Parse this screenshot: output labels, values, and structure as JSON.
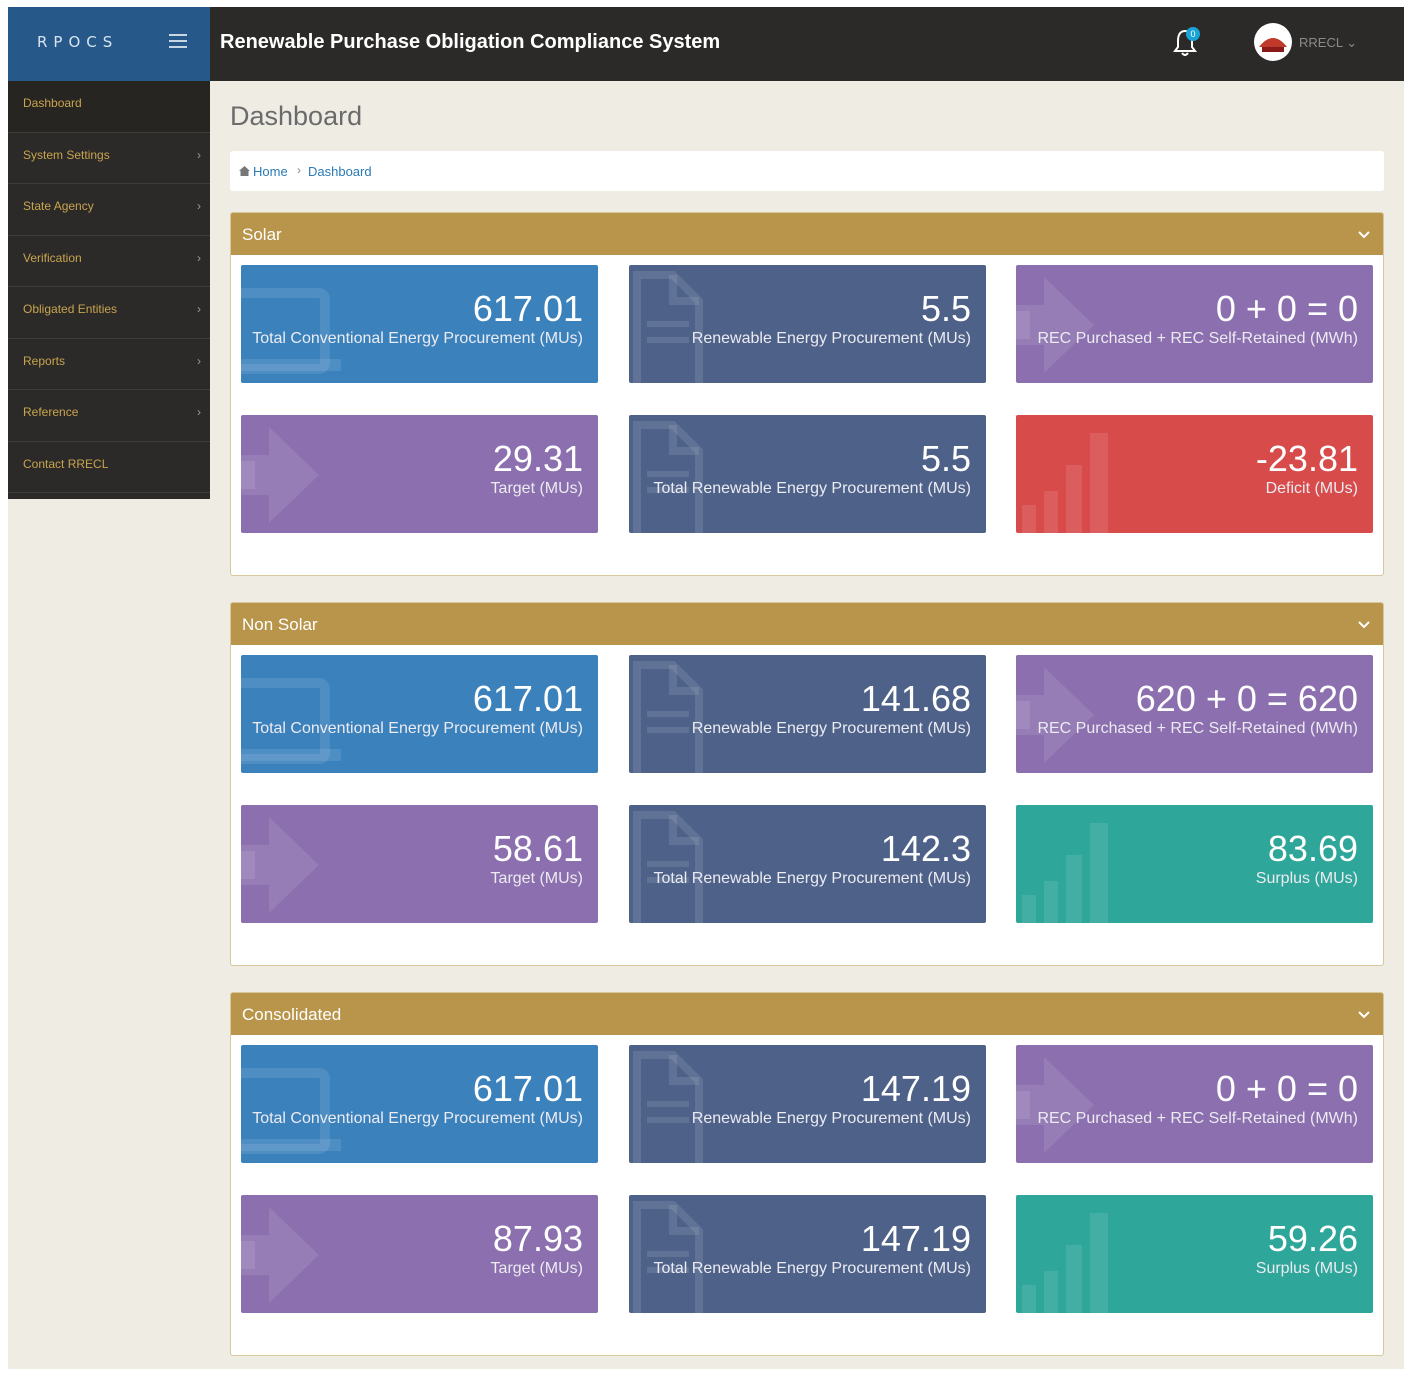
{
  "app": {
    "brand": "RPOCS",
    "title": "Renewable Purchase Obligation Compliance System",
    "notification_count": "0",
    "user": "RRECL"
  },
  "sidebar": {
    "items": [
      {
        "label": "Dashboard",
        "has_submenu": false
      },
      {
        "label": "System Settings",
        "has_submenu": true
      },
      {
        "label": "State Agency",
        "has_submenu": true
      },
      {
        "label": "Verification",
        "has_submenu": true
      },
      {
        "label": "Obligated Entities",
        "has_submenu": true
      },
      {
        "label": "Reports",
        "has_submenu": true
      },
      {
        "label": "Reference",
        "has_submenu": true
      },
      {
        "label": "Contact RRECL",
        "has_submenu": false
      }
    ]
  },
  "page": {
    "title": "Dashboard",
    "breadcrumb": [
      "Home",
      "Dashboard"
    ]
  },
  "colors": {
    "blue": "#3b82bd",
    "slate": "#4e6289",
    "purple": "#8b6fae",
    "red": "#d84b4b",
    "teal": "#2ea69a",
    "panel_header": "#b8954a"
  },
  "panels": [
    {
      "title": "Solar",
      "tiles": [
        {
          "value": "617.01",
          "label": "Total Conventional Energy Procurement (MUs)",
          "color": "blue",
          "icon": "document-icon"
        },
        {
          "value": "5.5",
          "label": "Renewable Energy Procurement (MUs)",
          "color": "slate",
          "icon": "file-icon"
        },
        {
          "value": "0 + 0 = 0",
          "label": "REC Purchased + REC Self-Retained (MWh)",
          "color": "purple",
          "icon": "arrow-icon"
        },
        {
          "value": "29.31",
          "label": "Target (MUs)",
          "color": "purple",
          "icon": "arrow-icon"
        },
        {
          "value": "5.5",
          "label": "Total Renewable Energy Procurement (MUs)",
          "color": "slate",
          "icon": "file-icon"
        },
        {
          "value": "-23.81",
          "label": "Deficit (MUs)",
          "color": "red",
          "icon": "bar-chart-icon"
        }
      ]
    },
    {
      "title": "Non Solar",
      "tiles": [
        {
          "value": "617.01",
          "label": "Total Conventional Energy Procurement (MUs)",
          "color": "blue",
          "icon": "document-icon"
        },
        {
          "value": "141.68",
          "label": "Renewable Energy Procurement (MUs)",
          "color": "slate",
          "icon": "file-icon"
        },
        {
          "value": "620 + 0 = 620",
          "label": "REC Purchased + REC Self-Retained (MWh)",
          "color": "purple",
          "icon": "arrow-icon"
        },
        {
          "value": "58.61",
          "label": "Target (MUs)",
          "color": "purple",
          "icon": "arrow-icon"
        },
        {
          "value": "142.3",
          "label": "Total Renewable Energy Procurement (MUs)",
          "color": "slate",
          "icon": "file-icon"
        },
        {
          "value": "83.69",
          "label": "Surplus (MUs)",
          "color": "teal",
          "icon": "bar-chart-icon"
        }
      ]
    },
    {
      "title": "Consolidated",
      "tiles": [
        {
          "value": "617.01",
          "label": "Total Conventional Energy Procurement (MUs)",
          "color": "blue",
          "icon": "document-icon"
        },
        {
          "value": "147.19",
          "label": "Renewable Energy Procurement (MUs)",
          "color": "slate",
          "icon": "file-icon"
        },
        {
          "value": "0 + 0 = 0",
          "label": "REC Purchased + REC Self-Retained (MWh)",
          "color": "purple",
          "icon": "arrow-icon"
        },
        {
          "value": "87.93",
          "label": "Target (MUs)",
          "color": "purple",
          "icon": "arrow-icon"
        },
        {
          "value": "147.19",
          "label": "Total Renewable Energy Procurement (MUs)",
          "color": "slate",
          "icon": "file-icon"
        },
        {
          "value": "59.26",
          "label": "Surplus (MUs)",
          "color": "teal",
          "icon": "bar-chart-icon"
        }
      ]
    }
  ]
}
